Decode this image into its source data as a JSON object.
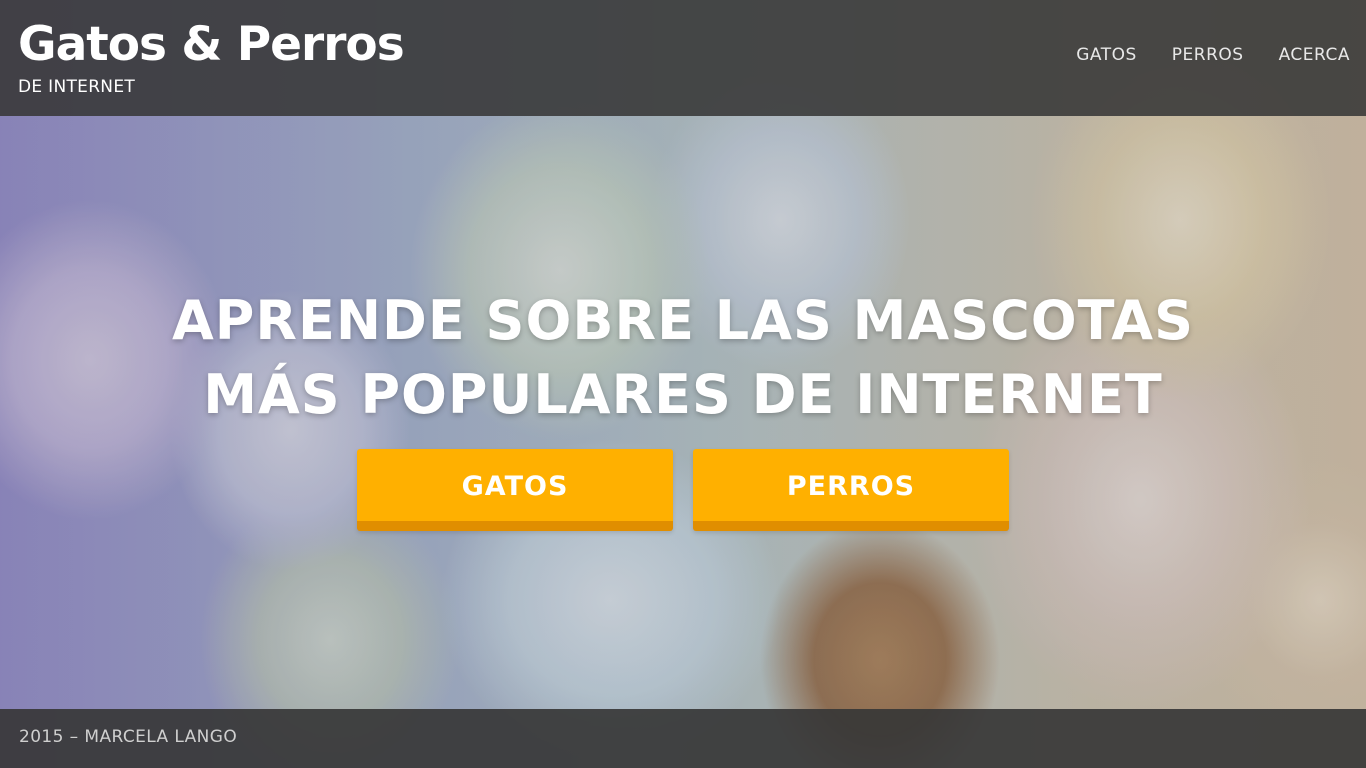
{
  "header": {
    "brand_title": "Gatos & Perros",
    "brand_subtitle": "DE INTERNET",
    "nav": [
      "GATOS",
      "PERROS",
      "ACERCA"
    ]
  },
  "hero": {
    "headline_line1": "APRENDE SOBRE LAS MASCOTAS",
    "headline_line2": "MÁS POPULARES DE INTERNET",
    "buttons": [
      "GATOS",
      "PERROS"
    ],
    "background_image": "plush-cats-and-dogs-photo"
  },
  "footer": {
    "text": "2015 – MARCELA LANGO"
  },
  "colors": {
    "bar_background": "#373737",
    "button_accent": "#ffb000",
    "button_accent_dark": "#e08e00",
    "text_primary": "#ffffff"
  }
}
